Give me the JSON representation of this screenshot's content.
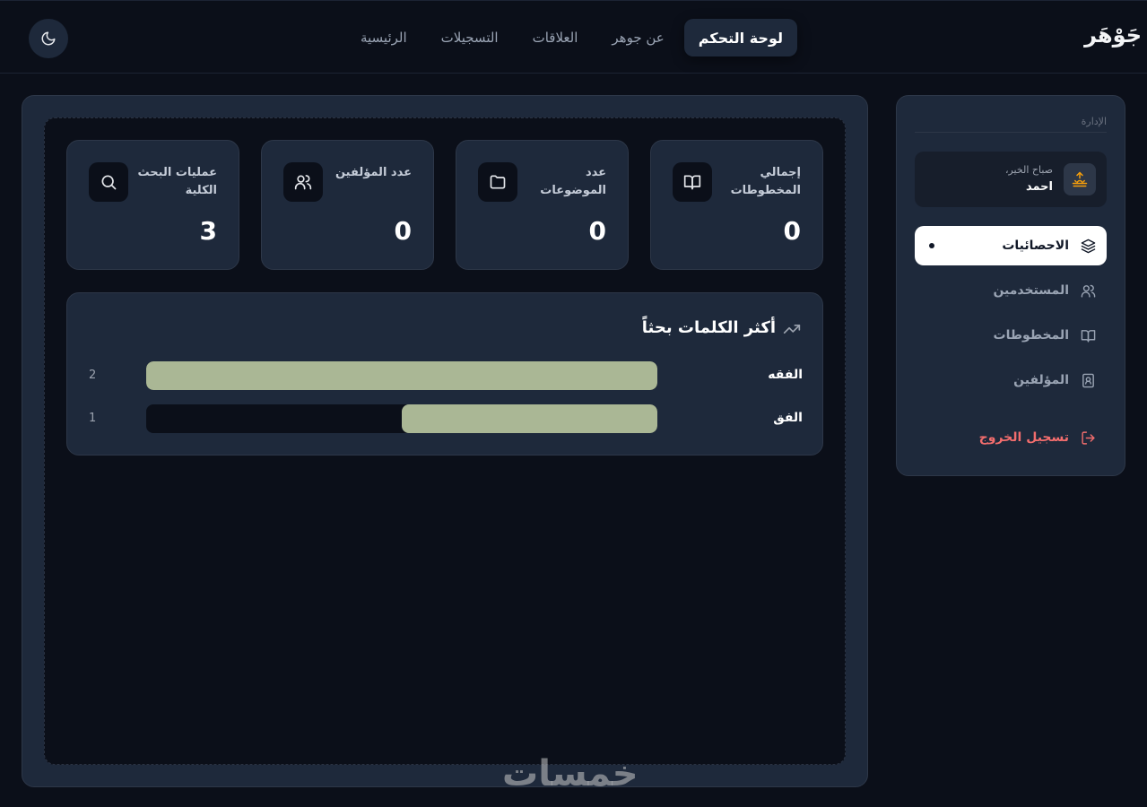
{
  "header": {
    "brand": "جَوْهَر",
    "nav": [
      {
        "label": "لوحة التحكم",
        "active": true
      },
      {
        "label": "عن جوهر",
        "active": false
      },
      {
        "label": "العلاقات",
        "active": false
      },
      {
        "label": "التسجيلات",
        "active": false
      },
      {
        "label": "الرئيسية",
        "active": false
      }
    ],
    "theme_icon": "moon-icon"
  },
  "sidebar": {
    "section_title": "الإدارة",
    "user": {
      "greeting": "صباح الخير،",
      "name": "احمد",
      "avatar_icon": "sunrise-icon"
    },
    "items": [
      {
        "label": "الاحصائيات",
        "icon": "layers-icon",
        "active": true
      },
      {
        "label": "المستخدمين",
        "icon": "users-icon",
        "active": false
      },
      {
        "label": "المخطوطات",
        "icon": "book-open-icon",
        "active": false
      },
      {
        "label": "المؤلفين",
        "icon": "contact-icon",
        "active": false
      }
    ],
    "logout": {
      "label": "تسجيل الخروج",
      "icon": "logout-icon"
    }
  },
  "stats": [
    {
      "label": "إجمالي المخطوطات",
      "value": "0",
      "icon": "book-open-icon"
    },
    {
      "label": "عدد الموضوعات",
      "value": "0",
      "icon": "folder-icon"
    },
    {
      "label": "عدد المؤلفين",
      "value": "0",
      "icon": "users-icon"
    },
    {
      "label": "عمليات البحث الكلية",
      "value": "3",
      "icon": "search-icon"
    }
  ],
  "chart_data": {
    "type": "bar",
    "title": "أكثر الكلمات بحثاً",
    "categories": [
      "الفقه",
      "الفق"
    ],
    "values": [
      2,
      1
    ],
    "xlim": [
      0,
      2
    ]
  },
  "watermark": "خمسات",
  "colors": {
    "accent_bar": "#aab795",
    "logout": "#f26d6d",
    "avatar": "#f59e0b"
  }
}
